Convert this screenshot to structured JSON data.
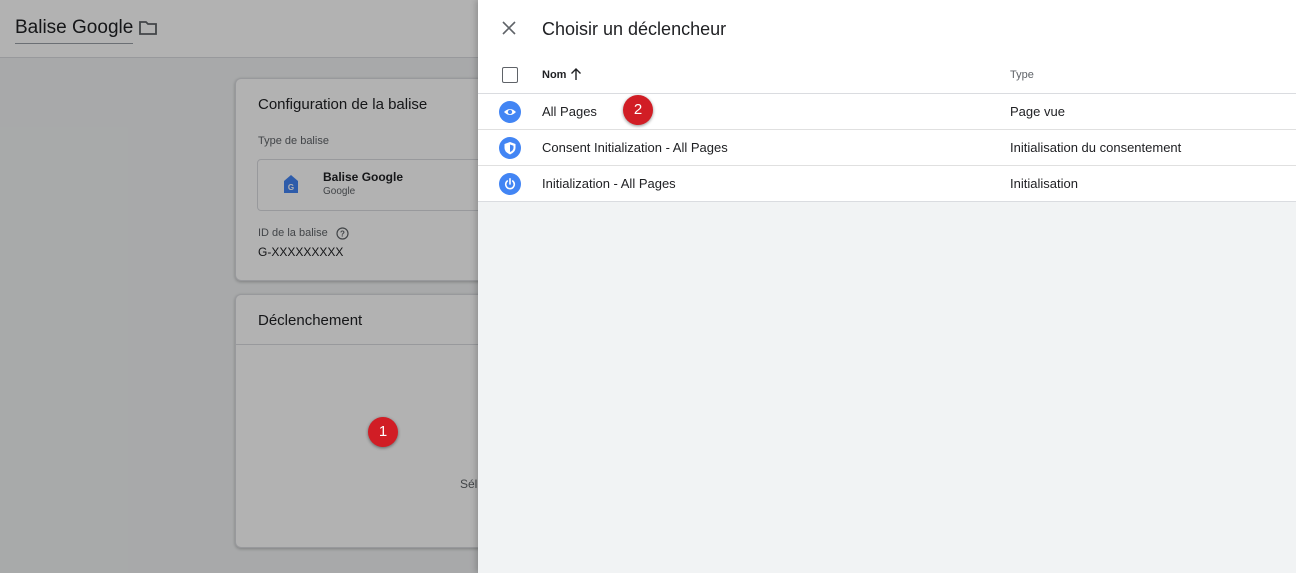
{
  "editor": {
    "tag_title": "Balise Google",
    "config_card": {
      "title": "Configuration de la balise",
      "type_label": "Type de balise",
      "tag_type_name": "Balise Google",
      "tag_type_vendor": "Google",
      "id_label": "ID de la balise",
      "id_value": "G-XXXXXXXXX"
    },
    "trigger_card": {
      "title": "Déclenchement",
      "hint_partial": "Sél"
    }
  },
  "annotations": {
    "step1": "1",
    "step2": "2",
    "badge_color": "#d11d25"
  },
  "panel": {
    "title": "Choisir un déclencheur",
    "columns": {
      "name": "Nom",
      "type": "Type",
      "sort": "ascending"
    },
    "rows": [
      {
        "name": "All Pages",
        "type": "Page vue",
        "icon": "eye-icon"
      },
      {
        "name": "Consent Initialization - All Pages",
        "type": "Initialisation du consentement",
        "icon": "shield-icon"
      },
      {
        "name": "Initialization - All Pages",
        "type": "Initialisation",
        "icon": "power-icon"
      }
    ],
    "accent_color": "#4285f4"
  }
}
